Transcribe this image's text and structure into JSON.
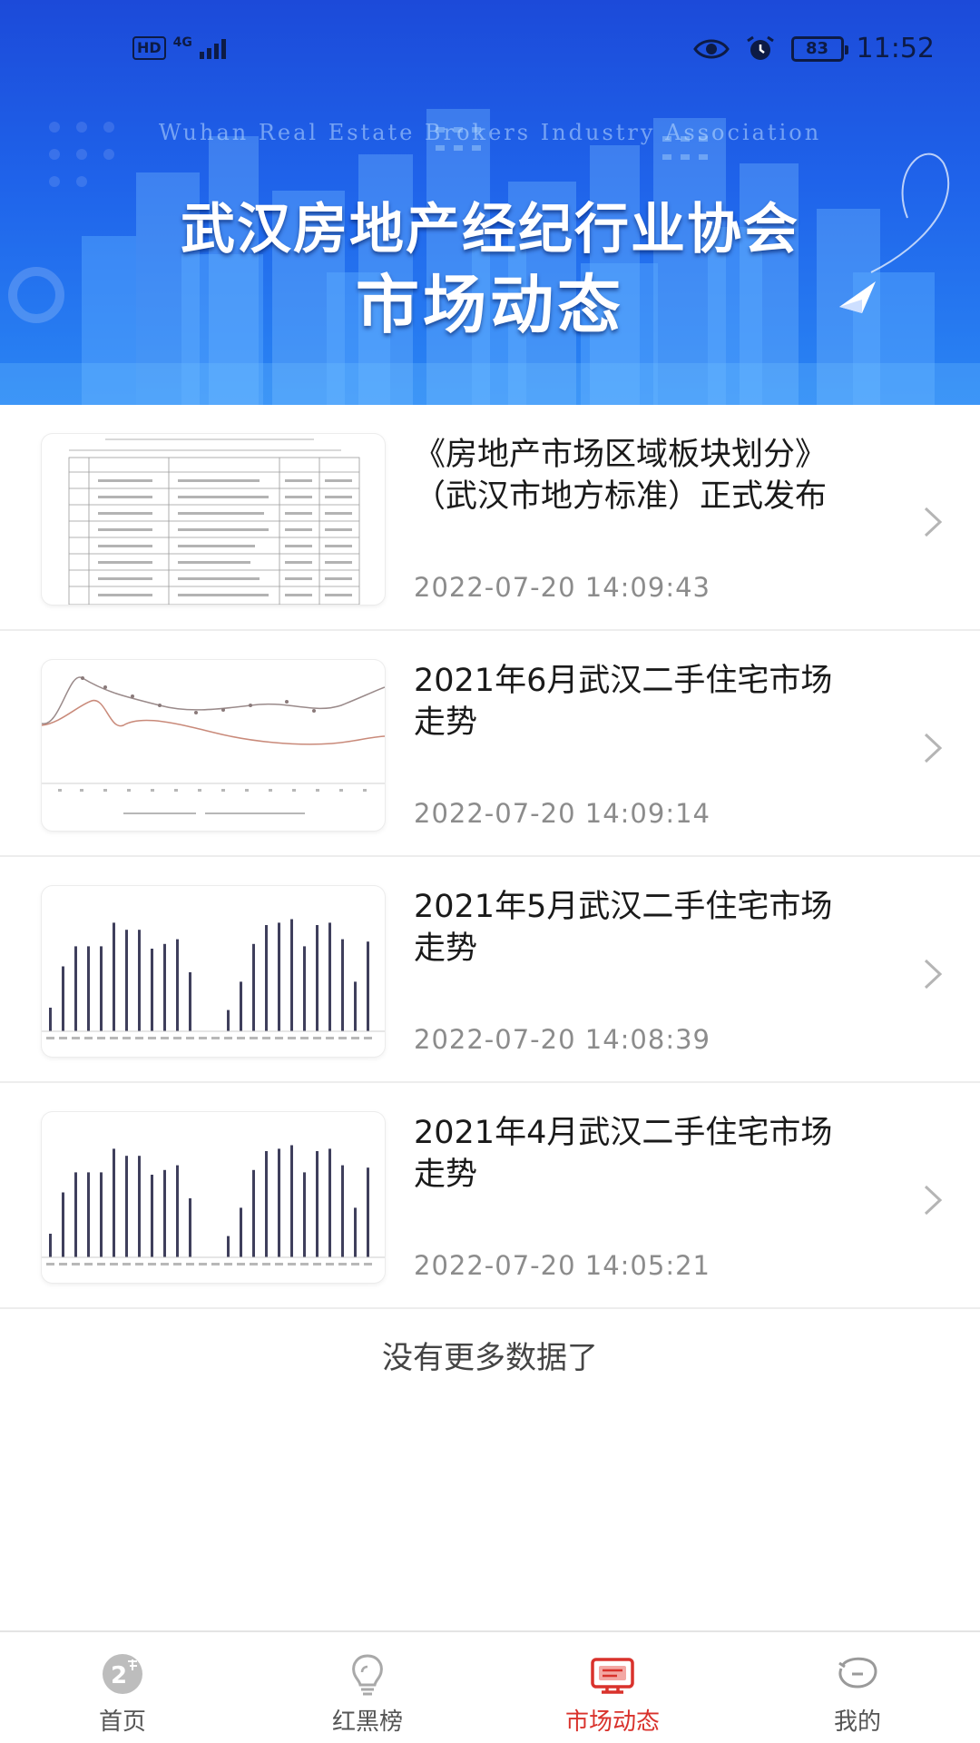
{
  "status_bar": {
    "left_badge": "HD",
    "network": "4G",
    "battery": "83",
    "time": "11:52"
  },
  "banner": {
    "english": "Wuhan  Real Estate Brokers Industry Association",
    "title": "武汉房地产经纪行业协会",
    "subtitle": "市场动态"
  },
  "news": [
    {
      "title": "《房地产市场区域板块划分》（武汉市地方标准）正式发布",
      "date": "2022-07-20 14:09:43",
      "thumb_type": "table-document"
    },
    {
      "title": "2021年6月武汉二手住宅市场走势",
      "date": "2022-07-20 14:09:14",
      "thumb_type": "line-chart"
    },
    {
      "title": "2021年5月武汉二手住宅市场走势",
      "date": "2022-07-20 14:08:39",
      "thumb_type": "bar-chart"
    },
    {
      "title": "2021年4月武汉二手住宅市场走势",
      "date": "2022-07-20 14:05:21",
      "thumb_type": "bar-chart"
    }
  ],
  "no_more": "没有更多数据了",
  "tabbar": {
    "items": [
      {
        "label": "首页",
        "icon": "home-icon"
      },
      {
        "label": "红黑榜",
        "icon": "bulb-icon"
      },
      {
        "label": "市场动态",
        "icon": "market-icon"
      },
      {
        "label": "我的",
        "icon": "profile-icon"
      }
    ],
    "active_index": 2
  },
  "colors": {
    "accent": "#d9322c",
    "banner_blue": "#1f63ea",
    "text": "#1a1a1a",
    "date": "#8c8c8c"
  }
}
